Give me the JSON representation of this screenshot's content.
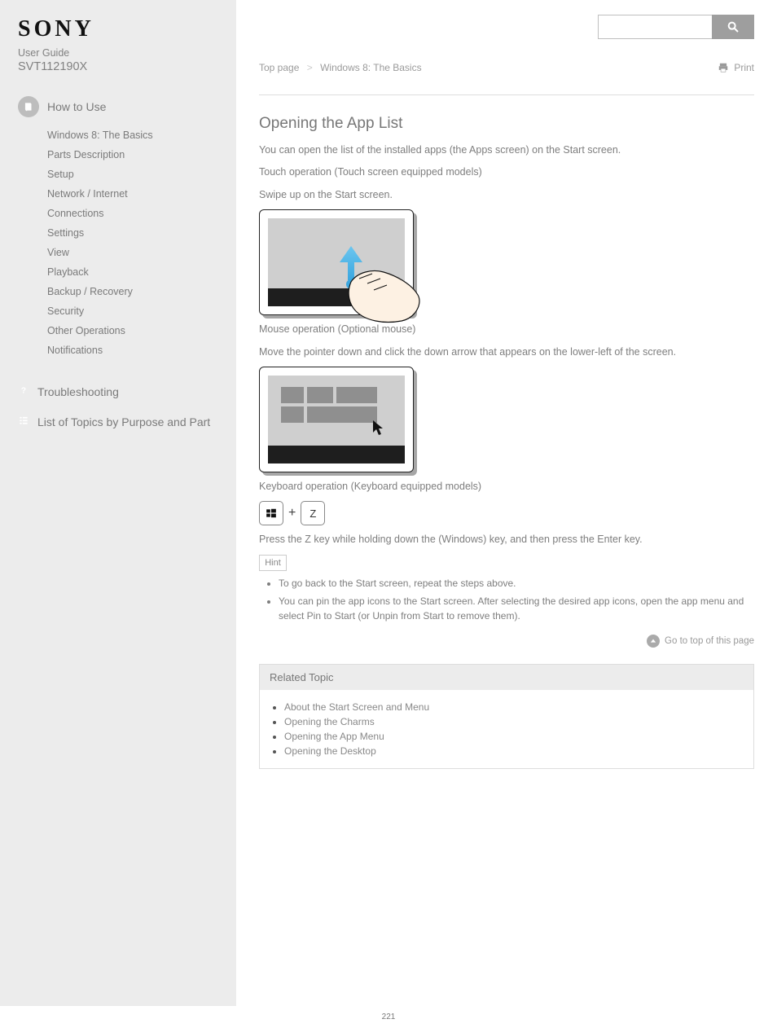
{
  "brand": "SONY",
  "subhead": "User Guide",
  "model": "SVT112190X",
  "sidebar": {
    "howto": {
      "title": "How to Use",
      "items": [
        "Windows 8: The Basics",
        "Parts Description",
        "Setup",
        "Network / Internet",
        "Connections",
        "Settings",
        "View",
        "Playback",
        "Backup / Recovery",
        "Security",
        "Other Operations",
        "Notifications"
      ]
    },
    "trouble": "Troubleshooting",
    "parts": "List of Topics by Purpose and Part"
  },
  "crumb": {
    "top": "Top page",
    "sep": ">",
    "section": "Windows 8: The Basics"
  },
  "print": "Print",
  "article": {
    "title": "Opening the App List",
    "intro": "You can open the list of the installed apps (the Apps screen) on the Start screen.",
    "touch_h": "Touch operation (Touch screen equipped models)",
    "touch_p": "Swipe up on the Start screen.",
    "mouse_h": "Mouse operation (Optional mouse)",
    "mouse_p": "Move the pointer down and click the down arrow that appears on the lower-left of the screen.",
    "key_h": "Keyboard operation (Keyboard equipped models)",
    "key_p": "Press the Z key while holding down the    (Windows) key, and then press the Enter key.",
    "z": "Z",
    "hint_label": "Hint",
    "hints": [
      "To go back to the Start screen, repeat the steps above.",
      "You can pin the app icons to the Start screen. After selecting the desired app icons, open the app menu and select Pin to Start (or Unpin from Start to remove them)."
    ]
  },
  "gotop": "Go to top of this page",
  "related": {
    "title": "Related Topic",
    "items": [
      "About the Start Screen and Menu",
      "Opening the Charms",
      "Opening the App Menu",
      "Opening the Desktop"
    ]
  },
  "page_number": "221"
}
